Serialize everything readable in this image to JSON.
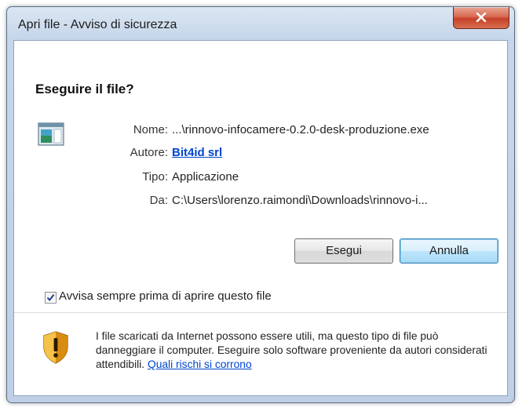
{
  "window": {
    "title": "Apri file - Avviso di sicurezza",
    "close_symbol": "X"
  },
  "dialog": {
    "heading": "Eseguire il file?",
    "file_icon": "application-window-icon",
    "fields": {
      "name_label": "Nome:",
      "name_value": "...\\rinnovo-infocamere-0.2.0-desk-produzione.exe",
      "author_label": "Autore:",
      "author_value": "Bit4id srl",
      "type_label": "Tipo:",
      "type_value": "Applicazione",
      "from_label": "Da:",
      "from_value": "C:\\Users\\lorenzo.raimondi\\Downloads\\rinnovo-i..."
    },
    "buttons": {
      "run": "Esegui",
      "cancel": "Annulla"
    },
    "checkbox": {
      "label": "Avvisa sempre prima di aprire questo file",
      "checked": true
    },
    "warning": {
      "icon": "security-shield-warning-icon",
      "text": "I file scaricati da Internet possono essere utili, ma questo tipo di file può danneggiare il computer. Eseguire solo software proveniente da autori considerati attendibili.",
      "link": "Quali rischi si corrono"
    }
  }
}
